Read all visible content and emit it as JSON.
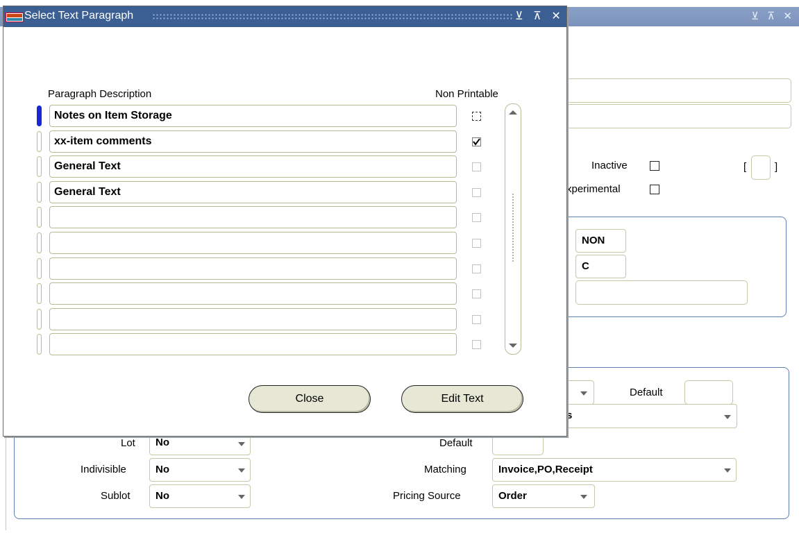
{
  "modal": {
    "title": "Select Text Paragraph",
    "col_description": "Paragraph Description",
    "col_nonprintable": "Non Printable",
    "rows": [
      {
        "description": "Notes on Item Storage",
        "non_printable": false,
        "active": true
      },
      {
        "description": "xx-item comments",
        "non_printable": true,
        "active": false
      },
      {
        "description": "General Text",
        "non_printable": false,
        "active": false
      },
      {
        "description": "General Text",
        "non_printable": false,
        "active": false
      },
      {
        "description": "",
        "non_printable": false,
        "active": false
      },
      {
        "description": "",
        "non_printable": false,
        "active": false
      },
      {
        "description": "",
        "non_printable": false,
        "active": false
      },
      {
        "description": "",
        "non_printable": false,
        "active": false
      },
      {
        "description": "",
        "non_printable": false,
        "active": false
      },
      {
        "description": "",
        "non_printable": false,
        "active": false
      }
    ],
    "close_label": "Close",
    "edit_text_label": "Edit Text",
    "window_controls": "⊻ ⊼ ✕"
  },
  "background": {
    "window_controls": "⊻ ⊼ ✕",
    "inactive_label": "Inactive",
    "experimental_label": "xperimental",
    "bracket_left": "[",
    "bracket_right": "]",
    "field_non": "NON",
    "field_c": "C",
    "default_label_top": "Default",
    "partial_value": "s",
    "lot_label": "Lot",
    "lot_value": "No",
    "indivisible_label": "Indivisible",
    "indivisible_value": "No",
    "sublot_label": "Sublot",
    "sublot_value": "No",
    "default_label": "Default",
    "matching_label": "Matching",
    "matching_value": "Invoice,PO,Receipt",
    "pricing_source_label": "Pricing Source",
    "pricing_source_value": "Order"
  }
}
